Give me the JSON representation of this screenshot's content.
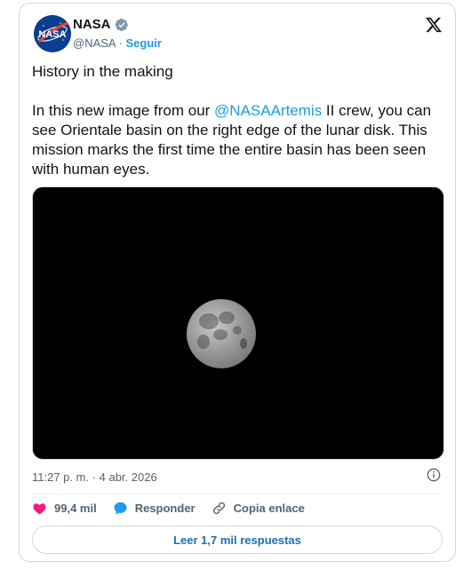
{
  "author": {
    "name": "NASA",
    "handle": "@NASA",
    "separator": "·",
    "follow_label": "Seguir",
    "avatar_icon": "nasa-logo",
    "verified_color": "#829aab"
  },
  "tweet": {
    "line1": "History in the making",
    "para_prefix": "In this new image from our ",
    "mention": "@NASAArtemis",
    "para_suffix": " II crew, you can see Orientale basin on the right edge of the lunar disk. This mission marks the first time the entire basin has been seen with human eyes.",
    "timestamp": "11:27 p. m. · 4 abr. 2026"
  },
  "actions": {
    "likes": "99,4 mil",
    "reply_label": "Responder",
    "copy_label": "Copia enlace",
    "read_replies": "Leer 1,7 mil respuestas"
  },
  "colors": {
    "accent": "#1d9bf0",
    "heart": "#f91880",
    "reply_bubble": "#1d9bf0"
  }
}
